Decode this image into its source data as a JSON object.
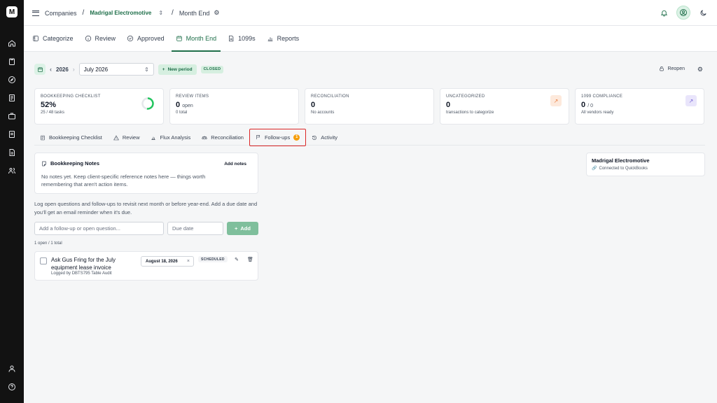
{
  "brand": {
    "logo": "M",
    "accent": "#1f6f4a"
  },
  "sidebar": {
    "icons": [
      "home-icon",
      "clipboard-icon",
      "compass-icon",
      "ledger-icon",
      "briefcase-icon",
      "document-icon",
      "file-icon",
      "users-icon",
      "user-icon",
      "help-icon"
    ]
  },
  "header": {
    "companies": "Companies",
    "company": "Madrigal Electromotive",
    "page": "Month End"
  },
  "nav": {
    "tabs": [
      {
        "label": "Categorize",
        "icon": "categorize-icon"
      },
      {
        "label": "Review",
        "icon": "info-icon"
      },
      {
        "label": "Approved",
        "icon": "check-circle-icon"
      },
      {
        "label": "Month End",
        "icon": "calendar-icon"
      },
      {
        "label": "1099s",
        "icon": "form-icon"
      },
      {
        "label": "Reports",
        "icon": "bar-chart-icon"
      }
    ],
    "active": "Month End"
  },
  "period": {
    "year": "2026",
    "month": "July 2026",
    "new_period": "New period",
    "status": "CLOSED",
    "reopen": "Reopen"
  },
  "cards": {
    "checklist": {
      "label": "BOOKKEEPING CHECKLIST",
      "value": "52%",
      "meta": "25 / 48 tasks",
      "progress": 0.52
    },
    "review": {
      "label": "REVIEW ITEMS",
      "value": "0",
      "value_sub": "open",
      "meta": "0 total"
    },
    "reconciliation": {
      "label": "RECONCILIATION",
      "value": "0",
      "meta": "No accounts"
    },
    "uncategorized": {
      "label": "UNCATEGORIZED",
      "value": "0",
      "meta": "transactions to categorize"
    },
    "compliance": {
      "label": "1099 COMPLIANCE",
      "value": "0",
      "value_sub": "/ 0",
      "meta": "All vendors ready"
    }
  },
  "subtabs": [
    {
      "label": "Bookkeeping Checklist",
      "icon": "checklist-icon"
    },
    {
      "label": "Review",
      "icon": "warning-icon"
    },
    {
      "label": "Flux Analysis",
      "icon": "bar-chart-icon"
    },
    {
      "label": "Reconciliation",
      "icon": "scale-icon"
    },
    {
      "label": "Follow-ups",
      "icon": "flag-icon",
      "badge": "1"
    },
    {
      "label": "Activity",
      "icon": "history-icon"
    }
  ],
  "notes": {
    "title": "Bookkeeping Notes",
    "add": "Add notes",
    "empty": "No notes yet. Keep client-specific reference notes here — things worth remembering that aren't action items."
  },
  "followups": {
    "help": "Log open questions and follow-ups to revisit next month or before year-end. Add a due date and you'll get an email reminder when it's due.",
    "input_placeholder": "Add a follow-up or open question...",
    "date_placeholder": "Due date",
    "add": "Add",
    "counts": "1 open / 1 total",
    "items": [
      {
        "title": "Ask Gus Fring for the July equipment lease invoice",
        "logged": "Logged by DBTS795 Table Audit",
        "due": "August 18, 2026",
        "status": "SCHEDULED"
      }
    ]
  },
  "company_card": {
    "name": "Madrigal Electromotive",
    "connection": "Connected to QuickBooks"
  }
}
